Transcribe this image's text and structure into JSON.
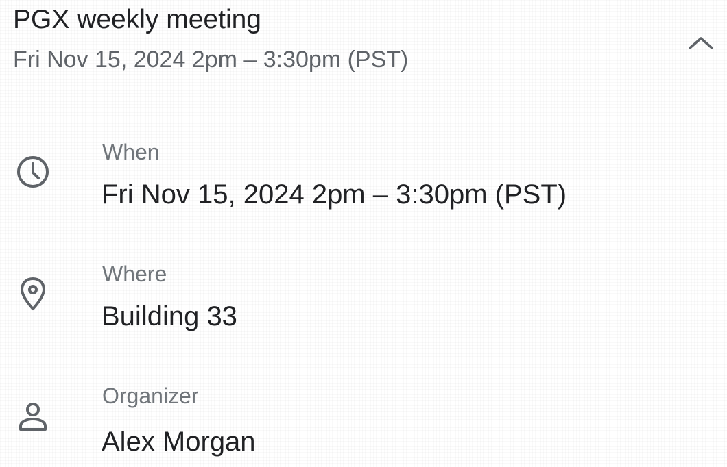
{
  "event": {
    "title": "PGX weekly meeting",
    "subtitle": "Fri Nov 15, 2024 2pm – 3:30pm (PST)",
    "collapse_icon": "chevron-up-icon"
  },
  "details": {
    "when": {
      "icon": "clock-icon",
      "label": "When",
      "value": "Fri Nov 15, 2024 2pm – 3:30pm (PST)"
    },
    "where": {
      "icon": "location-pin-icon",
      "label": "Where",
      "value": "Building 33"
    },
    "organizer": {
      "icon": "person-icon",
      "label": "Organizer",
      "value": "Alex Morgan"
    }
  },
  "colors": {
    "primary_text": "#202124",
    "secondary_text": "#5f6368",
    "label_text": "#70757a",
    "icon": "#5f6368"
  }
}
